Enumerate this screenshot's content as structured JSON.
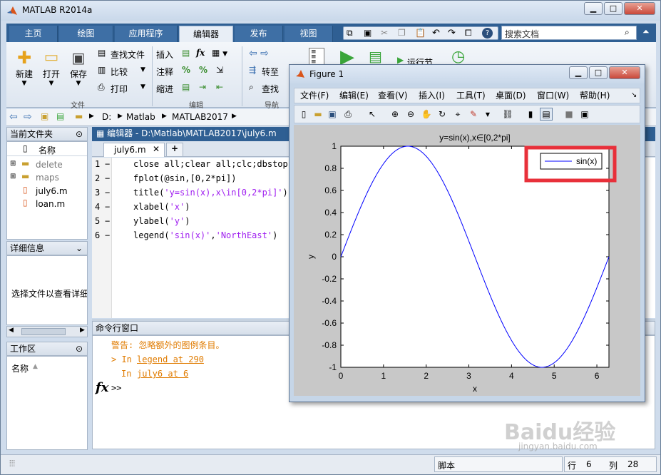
{
  "app": {
    "title": "MATLAB R2014a",
    "search_placeholder": "搜索文档"
  },
  "tabs": [
    "主页",
    "绘图",
    "应用程序",
    "编辑器",
    "发布",
    "视图"
  ],
  "ribbon": {
    "new": "新建",
    "open": "打开",
    "save": "保存",
    "find_files": "查找文件",
    "compare": "比较",
    "print": "打印",
    "group_file": "文件",
    "insert": "插入",
    "comment": "注释",
    "indent": "缩进",
    "fx": "fx",
    "group_edit": "编辑",
    "goto": "转至",
    "find": "查找",
    "group_nav": "导航",
    "run_section": "运行节"
  },
  "address": [
    "D:",
    "Matlab",
    "MATLAB2017"
  ],
  "current_folder": {
    "title": "当前文件夹",
    "col": "名称",
    "items": [
      "delete",
      "maps",
      "july6.m",
      "loan.m"
    ]
  },
  "details": {
    "title": "详细信息",
    "text": "选择文件以查看详细"
  },
  "workspace": {
    "title": "工作区",
    "col": "名称"
  },
  "editor": {
    "title": "编辑器 - D:\\Matlab\\MATLAB2017\\july6.m",
    "tab": "july6.m",
    "lines": [
      {
        "n": "1",
        "code": "close all;clear all;clc;dbstop"
      },
      {
        "n": "2",
        "code": "fplot(@sin,[0,2*pi])"
      },
      {
        "n": "3",
        "code": "title('y=sin(x),x\\in[0,2*pi]')"
      },
      {
        "n": "4",
        "code": "xlabel('x')"
      },
      {
        "n": "5",
        "code": "ylabel('y')"
      },
      {
        "n": "6",
        "code": "legend('sin(x)','NorthEast')"
      }
    ]
  },
  "command": {
    "title": "命令行窗口",
    "warn": "警告: 忽略额外的图例条目。",
    "l1_prefix": "> In ",
    "l1_link": "legend at 290",
    "l2_prefix": "In ",
    "l2_link": "july6 at 6",
    "prompt": ">>",
    "fx": "fx"
  },
  "figure": {
    "title": "Figure 1",
    "menus": [
      "文件(F)",
      "编辑(E)",
      "查看(V)",
      "插入(I)",
      "工具(T)",
      "桌面(D)",
      "窗口(W)",
      "帮助(H)"
    ]
  },
  "status": {
    "mode": "脚本",
    "row_label": "行",
    "row": "6",
    "col_label": "列",
    "col": "28"
  },
  "watermark": {
    "text": "Baidu经验",
    "url": "jingyan.baidu.com"
  },
  "chart_data": {
    "type": "line",
    "title": "y=sin(x),x∈[0,2*pi]",
    "xlabel": "x",
    "ylabel": "y",
    "xlim": [
      0,
      6.2832
    ],
    "ylim": [
      -1,
      1
    ],
    "xticks": [
      0,
      1,
      2,
      3,
      4,
      5,
      6
    ],
    "yticks": [
      -1,
      -0.8,
      -0.6,
      -0.4,
      -0.2,
      0,
      0.2,
      0.4,
      0.6,
      0.8,
      1
    ],
    "legend": "top-right",
    "series": [
      {
        "name": "sin(x)",
        "color": "#0000ff",
        "function": "sin",
        "x": [
          0,
          0.5,
          1,
          1.5708,
          2,
          2.5,
          3,
          3.5,
          4,
          4.5,
          4.7124,
          5,
          5.5,
          6,
          6.2832
        ],
        "values": [
          0,
          0.479,
          0.841,
          1,
          0.909,
          0.598,
          0.141,
          -0.351,
          -0.757,
          -0.978,
          -1,
          -0.959,
          -0.706,
          -0.279,
          0
        ]
      }
    ],
    "highlight_color": "#e8303a"
  }
}
